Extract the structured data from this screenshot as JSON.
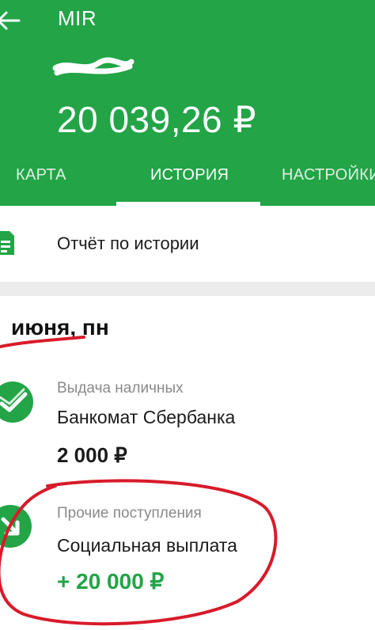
{
  "header": {
    "card_name": "MIR",
    "balance": "20 039,26 ₽"
  },
  "tabs": [
    {
      "label": "КАРТА"
    },
    {
      "label": "ИСТОРИЯ"
    },
    {
      "label": "НАСТРОЙКИ"
    }
  ],
  "report": {
    "label": "Отчёт по истории"
  },
  "date_header": "июня, пн",
  "transactions": [
    {
      "category": "Выдача наличных",
      "title": "Банкомат Сбербанка",
      "amount": "2 000 ₽"
    },
    {
      "category": "Прочие поступления",
      "title": "Социальная выплата",
      "amount": "+ 20 000 ₽"
    }
  ],
  "colors": {
    "brand_green": "#22a447",
    "annotation_red": "#d81b2a",
    "muted_text": "#8a8a8a"
  },
  "icons": [
    "back-arrow-icon",
    "document-icon",
    "sberbank-logo-icon",
    "incoming-arrow-icon"
  ]
}
